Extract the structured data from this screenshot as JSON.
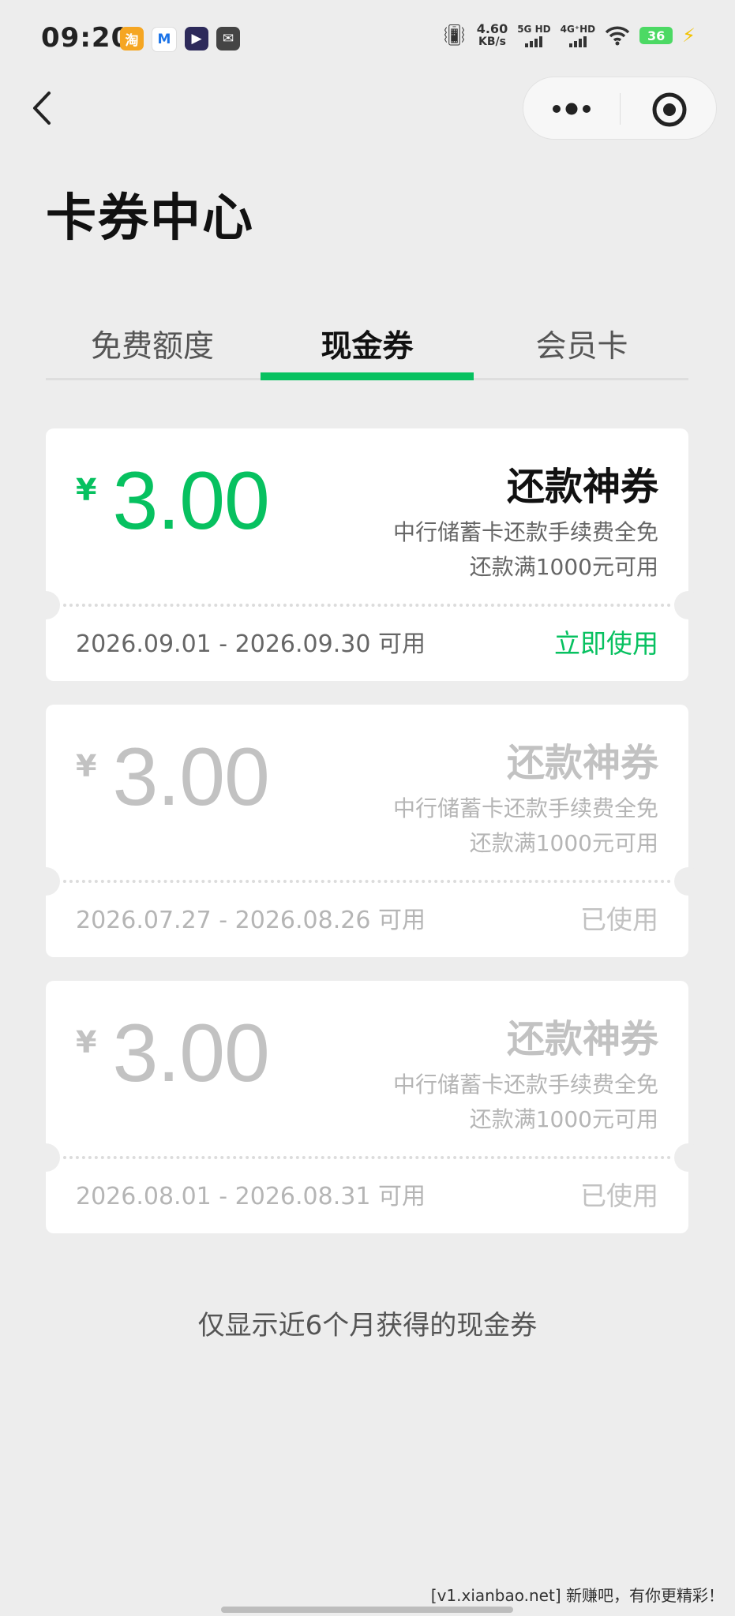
{
  "status_bar": {
    "time": "09:20",
    "apps": [
      {
        "icon": "taobao-icon",
        "glyph": "淘"
      },
      {
        "icon": "mail-app-icon",
        "glyph": "M"
      },
      {
        "icon": "video-app-icon",
        "glyph": "▶"
      },
      {
        "icon": "message-app-icon",
        "glyph": "✉"
      }
    ],
    "net_speed_value": "4.60",
    "net_speed_unit": "KB/s",
    "sim1": "5G HD",
    "sim2": "4G⁺HD",
    "battery": "36"
  },
  "nav": {
    "back_icon": "chevron-left-icon",
    "more_icon": "more-dots-icon",
    "close_icon": "close-circle-icon"
  },
  "page": {
    "title": "卡券中心"
  },
  "tabs": [
    {
      "label": "免费额度",
      "active": false
    },
    {
      "label": "现金券",
      "active": true
    },
    {
      "label": "会员卡",
      "active": false
    }
  ],
  "coupons": [
    {
      "currency": "¥",
      "amount": "3.00",
      "title": "还款神券",
      "desc_line1": "中行储蓄卡还款手续费全免",
      "desc_line2": "还款满1000元可用",
      "validity": "2026.09.01 - 2026.09.30 可用",
      "action": "立即使用",
      "status": "available"
    },
    {
      "currency": "¥",
      "amount": "3.00",
      "title": "还款神券",
      "desc_line1": "中行储蓄卡还款手续费全免",
      "desc_line2": "还款满1000元可用",
      "validity": "2026.07.27 - 2026.08.26 可用",
      "action": "已使用",
      "status": "used"
    },
    {
      "currency": "¥",
      "amount": "3.00",
      "title": "还款神券",
      "desc_line1": "中行储蓄卡还款手续费全免",
      "desc_line2": "还款满1000元可用",
      "validity": "2026.08.01 - 2026.08.31 可用",
      "action": "已使用",
      "status": "used"
    }
  ],
  "footer_note": "仅显示近6个月获得的现金券",
  "watermark": "[v1.xianbao.net] 新赚吧，有你更精彩！",
  "colors": {
    "accent": "#07c160",
    "used": "#c2c2c2",
    "background": "#ededed"
  }
}
